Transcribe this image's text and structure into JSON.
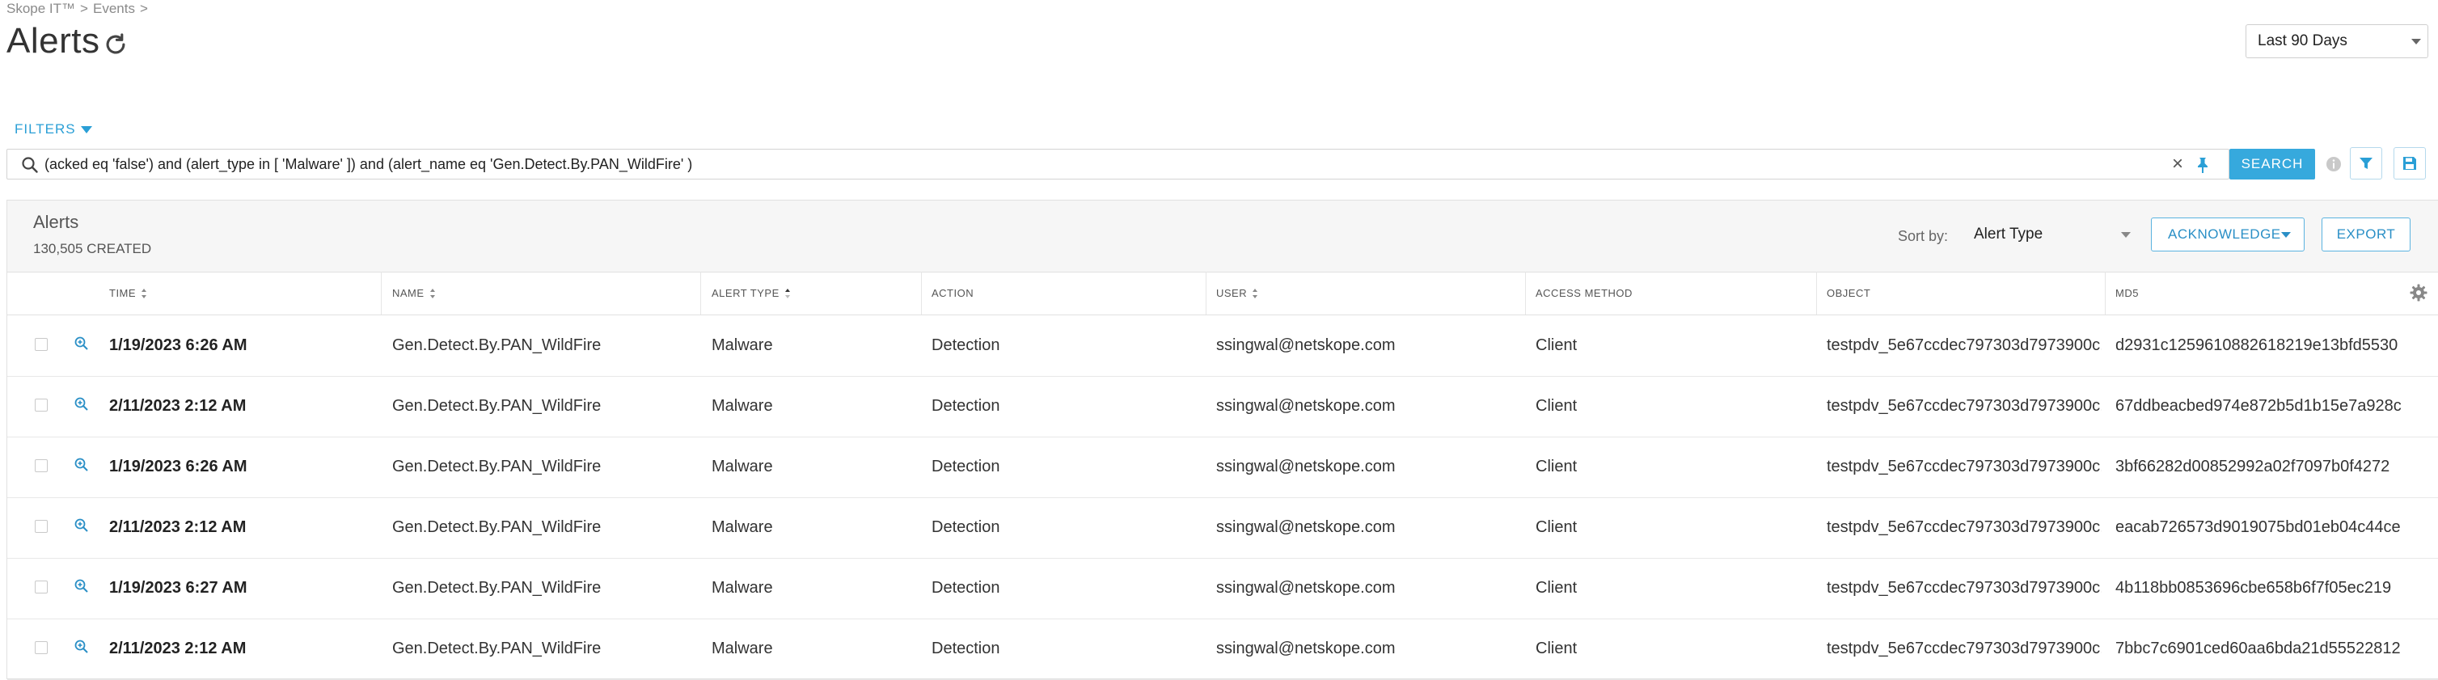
{
  "breadcrumb": [
    "Skope IT™",
    "Events"
  ],
  "page_title": "Alerts",
  "time_range": "Last 90 Days",
  "filters_label": "FILTERS",
  "search": {
    "query": "(acked eq 'false') and (alert_type in [ 'Malware' ]) and (alert_name eq 'Gen.Detect.By.PAN_WildFire' )",
    "button_label": "SEARCH"
  },
  "panel": {
    "title": "Alerts",
    "count": "130,505 CREATED",
    "sort_label": "Sort by:",
    "sort_value": "Alert Type",
    "acknowledge_label": "ACKNOWLEDGE",
    "export_label": "EXPORT"
  },
  "columns": [
    "TIME",
    "NAME",
    "ALERT TYPE",
    "ACTION",
    "USER",
    "ACCESS METHOD",
    "OBJECT",
    "MD5"
  ],
  "rows": [
    {
      "time": "1/19/2023 6:26 AM",
      "name": "Gen.Detect.By.PAN_WildFire",
      "alert_type": "Malware",
      "action": "Detection",
      "user": "ssingwal@netskope.com",
      "access_method": "Client",
      "object": "testpdv_5e67ccdec797303d7973900c...",
      "md5": "d2931c1259610882618219e13bfd5530"
    },
    {
      "time": "2/11/2023 2:12 AM",
      "name": "Gen.Detect.By.PAN_WildFire",
      "alert_type": "Malware",
      "action": "Detection",
      "user": "ssingwal@netskope.com",
      "access_method": "Client",
      "object": "testpdv_5e67ccdec797303d7973900c...",
      "md5": "67ddbeacbed974e872b5d1b15e7a928c"
    },
    {
      "time": "1/19/2023 6:26 AM",
      "name": "Gen.Detect.By.PAN_WildFire",
      "alert_type": "Malware",
      "action": "Detection",
      "user": "ssingwal@netskope.com",
      "access_method": "Client",
      "object": "testpdv_5e67ccdec797303d7973900c...",
      "md5": "3bf66282d00852992a02f7097b0f4272"
    },
    {
      "time": "2/11/2023 2:12 AM",
      "name": "Gen.Detect.By.PAN_WildFire",
      "alert_type": "Malware",
      "action": "Detection",
      "user": "ssingwal@netskope.com",
      "access_method": "Client",
      "object": "testpdv_5e67ccdec797303d7973900c...",
      "md5": "eacab726573d9019075bd01eb04c44ce"
    },
    {
      "time": "1/19/2023 6:27 AM",
      "name": "Gen.Detect.By.PAN_WildFire",
      "alert_type": "Malware",
      "action": "Detection",
      "user": "ssingwal@netskope.com",
      "access_method": "Client",
      "object": "testpdv_5e67ccdec797303d7973900c...",
      "md5": "4b118bb0853696cbe658b6f7f05ec219"
    },
    {
      "time": "2/11/2023 2:12 AM",
      "name": "Gen.Detect.By.PAN_WildFire",
      "alert_type": "Malware",
      "action": "Detection",
      "user": "ssingwal@netskope.com",
      "access_method": "Client",
      "object": "testpdv_5e67ccdec797303d7973900c...",
      "md5": "7bbc7c6901ced60aa6bda21d55522812"
    }
  ],
  "colors": {
    "accent": "#36a9dd",
    "link": "#2a9fd6",
    "header_bg": "#f6f6f6"
  },
  "icons": [
    "refresh-icon",
    "search-icon",
    "clear-icon",
    "pin-icon",
    "info-icon",
    "filter-icon",
    "save-icon",
    "sort-icon",
    "gear-icon",
    "zoom-icon"
  ]
}
